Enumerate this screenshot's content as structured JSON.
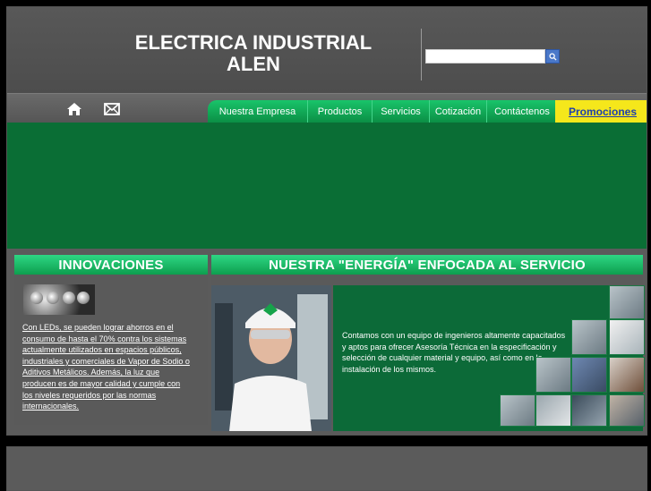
{
  "header": {
    "brand_line1": "ELECTRICA INDUSTRIAL",
    "brand_line2": "ALEN",
    "search_placeholder": ""
  },
  "nav": {
    "items": [
      "Nuestra Empresa",
      "Productos",
      "Servicios",
      "Cotización",
      "Contáctenos"
    ],
    "promo": "Promociones"
  },
  "innovaciones": {
    "title": "INNOVACIONES",
    "text": "Con LEDs, se pueden lograr ahorros en el consumo de hasta el 70% contra los sistemas actualmente utilizados en espacios públicos, industriales y comerciales de Vapor de Sodio o Aditivos Metálicos. Además, la luz que producen es de mayor calidad y cumple con los niveles requeridos por las normas internacionales."
  },
  "energia": {
    "title": "NUESTRA \"ENERGÍA\" ENFOCADA AL SERVICIO",
    "text": "Contamos con un equipo de ingenieros altamente capacitados y aptos para ofrecer Asesoría Técnica en la especificación y selección de cualquier material y equipo, así como en la instalación de los mismos."
  },
  "colors": {
    "accent_green": "#0a6e35",
    "promo_yellow": "#f5e71b",
    "promo_text": "#1e3fae"
  },
  "icons": [
    "home-icon",
    "mail-icon",
    "search-icon"
  ]
}
